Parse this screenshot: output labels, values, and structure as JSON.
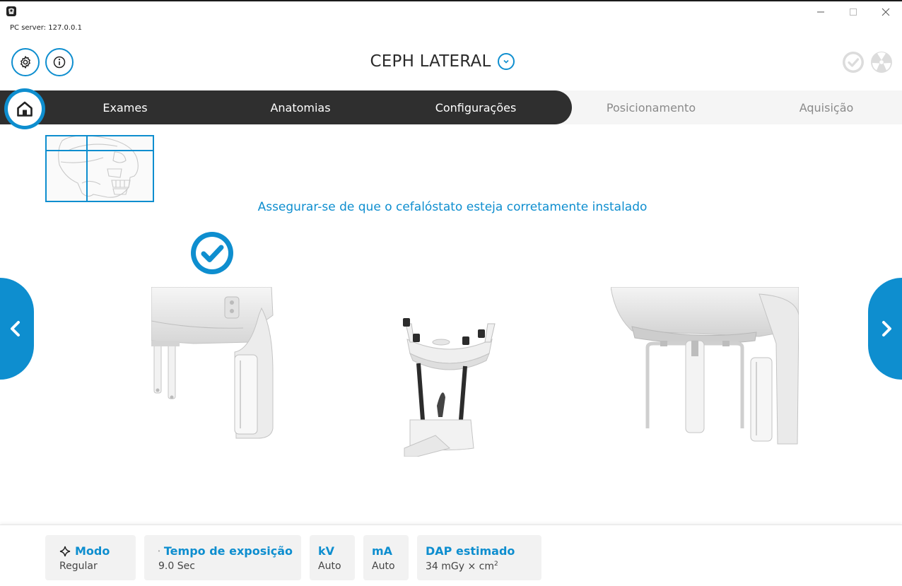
{
  "window": {
    "server_label": "PC server: 127.0.0.1",
    "controls": [
      "minimize-icon",
      "maximize-icon",
      "close-icon"
    ]
  },
  "header": {
    "settings_icon": "gear-icon",
    "info_icon": "info-icon",
    "exam_title": "CEPH LATERAL",
    "status_icons": [
      "check-circle-icon",
      "radiation-icon"
    ]
  },
  "nav": {
    "home_icon": "home-icon",
    "tabs": [
      {
        "label": "Exames",
        "active_section": true
      },
      {
        "label": "Anatomias",
        "active_section": true
      },
      {
        "label": "Configurações",
        "active_section": true
      },
      {
        "label": "Posicionamento",
        "active_section": false
      },
      {
        "label": "Aquisição",
        "active_section": false
      }
    ]
  },
  "main": {
    "instruction": "Assegurar-se de que o cefalóstato esteja corretamente instalado",
    "selected_option": 1,
    "options": [
      "cephalostat-device",
      "chin-rest-device",
      "panoramic-device"
    ]
  },
  "footer": {
    "mode": {
      "label": "Modo",
      "value": "Regular",
      "icon": "sparkle-icon"
    },
    "exposure": {
      "label": "Tempo de exposição",
      "value": "9.0 Sec",
      "icon": "radiation-icon"
    },
    "kv": {
      "label": "kV",
      "value": "Auto"
    },
    "ma": {
      "label": "mA",
      "value": "Auto"
    },
    "dap": {
      "label": "DAP estimado",
      "value": "34 mGy × cm",
      "unit_exponent": "2"
    }
  },
  "colors": {
    "accent": "#0e8ecf",
    "nav_dark": "#2f2f2f",
    "nav_light": "#f5f5f5",
    "card_bg": "#f2f2f2"
  }
}
